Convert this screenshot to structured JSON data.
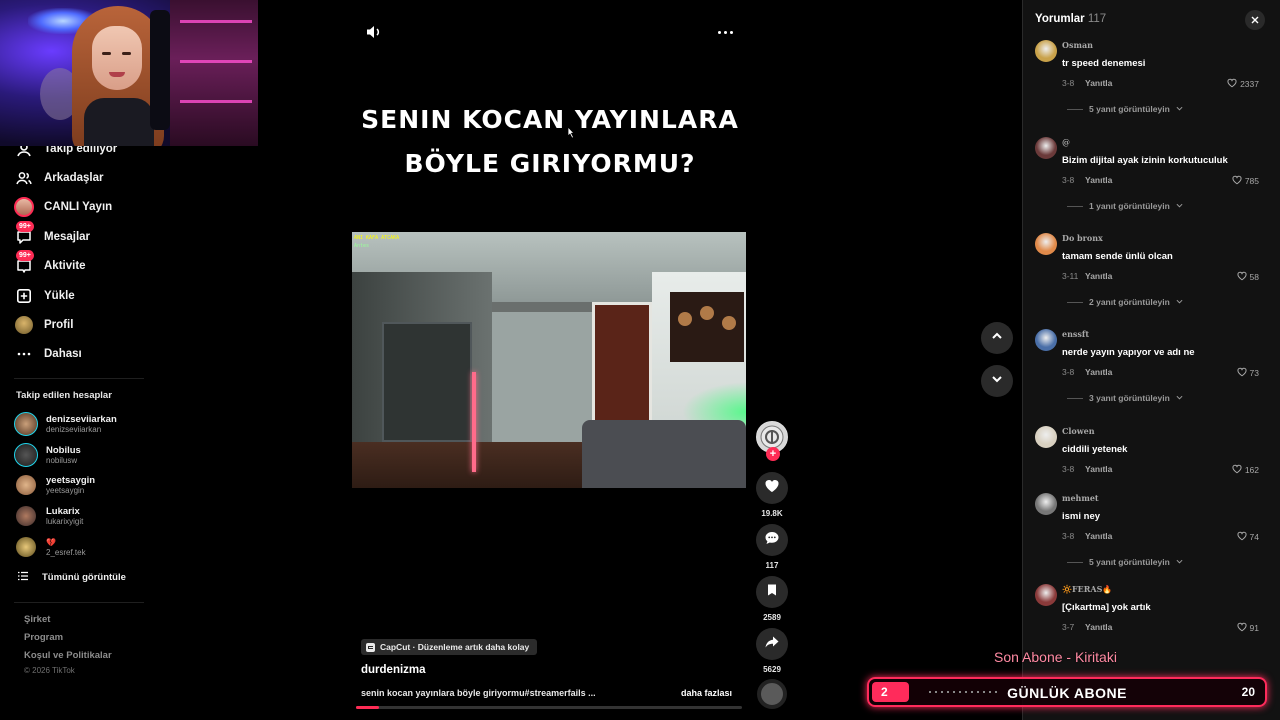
{
  "nav": {
    "items": [
      {
        "label": "Takip ediliyor",
        "icon": "following-icon"
      },
      {
        "label": "Arkadaşlar",
        "icon": "friends-icon"
      },
      {
        "label": "CANLI Yayın",
        "icon": "live-icon"
      },
      {
        "label": "Mesajlar",
        "icon": "messages-icon",
        "badge": "99+"
      },
      {
        "label": "Aktivite",
        "icon": "activity-icon",
        "badge": "99+"
      },
      {
        "label": "Yükle",
        "icon": "upload-icon"
      },
      {
        "label": "Profil",
        "icon": "profile-icon"
      },
      {
        "label": "Dahası",
        "icon": "more-icon"
      }
    ],
    "following_title": "Takip edilen hesaplar",
    "accounts": [
      {
        "name": "denizseviiarkan",
        "handle": "denizseviiarkan"
      },
      {
        "name": "Nobilus",
        "handle": "nobilusw"
      },
      {
        "name": "yeetsaygin",
        "handle": "yeetsaygin"
      },
      {
        "name": "Lukarix",
        "handle": "lukarixyigit"
      },
      {
        "name": "💔",
        "handle": "2_esref.tek"
      }
    ],
    "see_all": "Tümünü görüntüle",
    "footer_links": [
      "Şirket",
      "Program",
      "Koşul ve Politikalar"
    ],
    "copyright": "© 2026 TikTok"
  },
  "video": {
    "caption_lines": [
      "SENIN KOCAN YAYINLARA",
      "BÖYLE GIRIYORMU?"
    ],
    "capcut_label": "CapCut · Düzenleme artık daha kolay",
    "author": "durdenizma",
    "description": "senin kocan yayınlara böyle giriyormu#streamerfails ...",
    "more_label": "daha fazlası",
    "progress": 0.06,
    "hud_text": [
      "ANI KAFA ATCAKA",
      "Antes"
    ]
  },
  "actions": {
    "likes": "19.8K",
    "comments": "117",
    "saves": "2589",
    "shares": "5629",
    "follow_symbol": "+"
  },
  "comments_panel": {
    "title": "Yorumlar",
    "count": "117",
    "reply_label": "Yanıtla",
    "comments": [
      {
        "user": "Osman",
        "text": "tr speed denemesi",
        "date": "3-8",
        "likes": "2337",
        "view_replies": "5 yanıt görüntüleyin",
        "avatar_color": "#c9a24a"
      },
      {
        "user": "@",
        "text": "Bizim dijital ayak izinin korkutuculuk",
        "date": "3-8",
        "likes": "785",
        "view_replies": "1 yanıt görüntüleyin",
        "avatar_color": "#6b3a3a"
      },
      {
        "user": "Do bronx",
        "text": "tamam sende ünlü olcan",
        "date": "3-11",
        "likes": "58",
        "view_replies": "2 yanıt görüntüleyin",
        "avatar_color": "#e08a4a"
      },
      {
        "user": "enssft",
        "text": "nerde yayın yapıyor ve adı ne",
        "date": "3-8",
        "likes": "73",
        "view_replies": "3 yanıt görüntüleyin",
        "avatar_color": "#4a6fa8"
      },
      {
        "user": "Clowen",
        "text": "ciddili yetenek",
        "date": "3-8",
        "likes": "162",
        "view_replies": "",
        "avatar_color": "#d8d0c0"
      },
      {
        "user": "mehmet",
        "text": "ismi ney",
        "date": "3-8",
        "likes": "74",
        "view_replies": "5 yanıt görüntüleyin",
        "avatar_color": "#777777"
      },
      {
        "user": "🔆FERAS🔥",
        "text": "[Çıkartma] yok artık",
        "date": "3-7",
        "likes": "91",
        "view_replies": "",
        "avatar_color": "#8a3a3a"
      }
    ]
  },
  "overlay": {
    "last_sub": "Son Abone - Kiritaki",
    "goal_label": "GÜNLÜK ABONE",
    "goal_current": "2",
    "goal_target": "20",
    "goal_fraction": 0.1,
    "accent": "#ff2b5b"
  },
  "colors": {
    "tiktok_red": "#fe2c55",
    "panel_bg": "#121212"
  }
}
